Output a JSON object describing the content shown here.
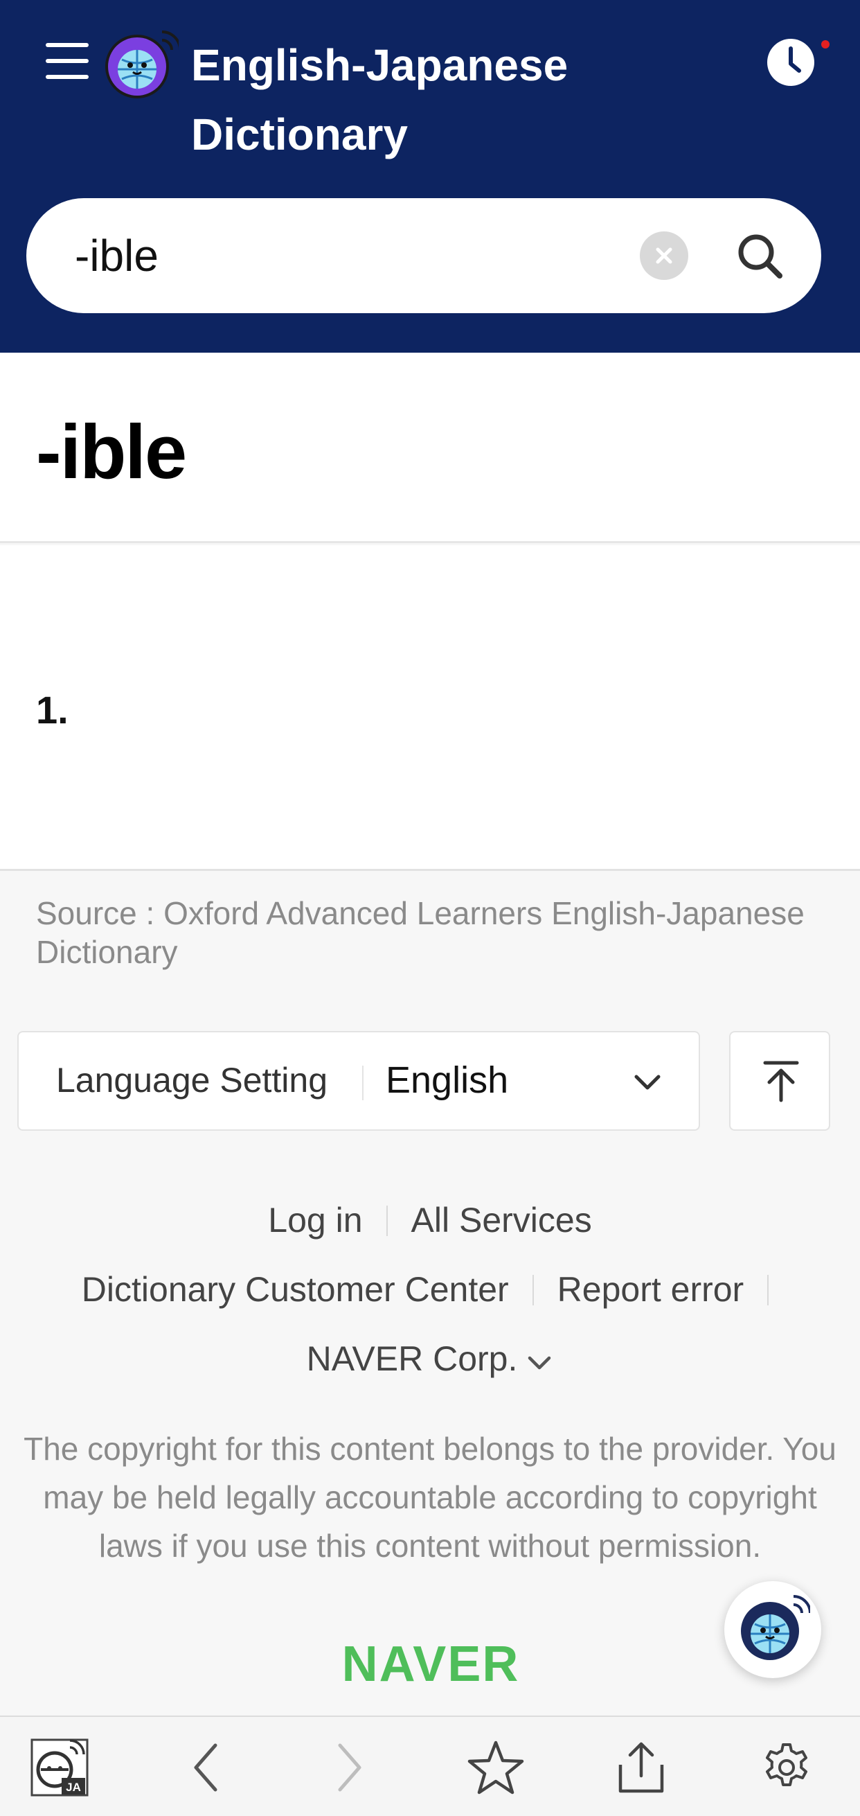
{
  "header": {
    "title": "English-Japanese Dictionary",
    "colors": {
      "background": "#0d2461",
      "notification_dot": "#e42020"
    },
    "icons": {
      "menu": "hamburger-icon",
      "logo": "dictionary-globe-mascot",
      "history": "clock-icon"
    }
  },
  "search": {
    "value": "-ible",
    "icons": {
      "clear": "clear-x-icon",
      "submit": "search-icon"
    }
  },
  "entry": {
    "word": "-ible",
    "senses": [
      {
        "number": "1."
      }
    ]
  },
  "footer": {
    "source": "Source : Oxford Advanced Learners English-Japanese Dictionary",
    "language": {
      "label": "Language Setting",
      "selected": "English"
    },
    "links_row1": [
      "Log in",
      "All Services"
    ],
    "links_row2": [
      "Dictionary Customer Center",
      "Report error"
    ],
    "company": "NAVER Corp.",
    "copyright": "The copyright for this content belongs to the provider. You may be held legally accountable according to copyright laws if you use this content without permission.",
    "brand": "NAVER",
    "brand_color": "#4fbe5a"
  },
  "bottom_bar": {
    "icons": [
      "ja-dictionary-icon",
      "back-arrow-icon",
      "forward-arrow-icon",
      "star-icon",
      "share-icon",
      "settings-gear-icon"
    ]
  }
}
